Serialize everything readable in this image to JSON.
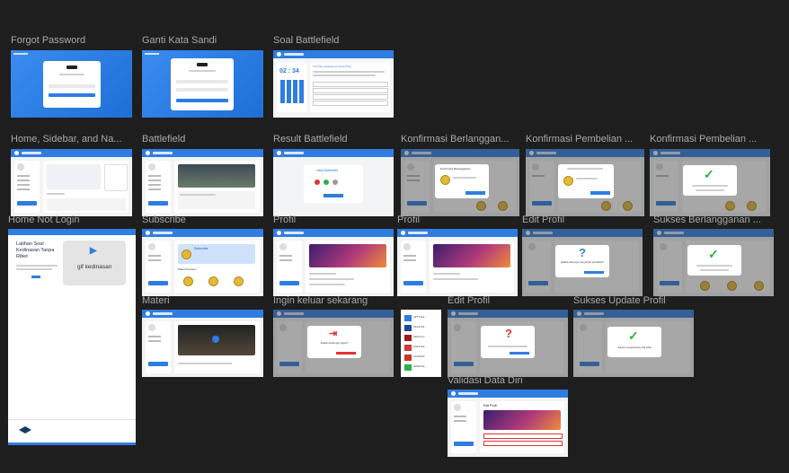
{
  "frames": {
    "forgot_password": "Forgot Password",
    "ganti_kata_sandi": "Ganti Kata Sandi",
    "soal_battlefield": "Soal Battlefield",
    "home_sidebar": "Home, Sidebar, and Na...",
    "battlefield": "Battlefield",
    "result_battlefield": "Result Battlefield",
    "konfirmasi_berlangganan": "Konfirmasi Berlanggan...",
    "konfirmasi_pembelian_1": "Konfirmasi Pembelian ...",
    "konfirmasi_pembelian_2": "Konfirmasi Pembelian ...",
    "home_not_login": "Home Not Login",
    "subscribe": "Subscribe",
    "profil_1": "Profil",
    "profil_2": "Profil",
    "edit_profil_1": "Edit Profil",
    "sukses_berlangganan": "Sukses Berlangganan ...",
    "materi": "Materi",
    "ingin_keluar": "Ingin keluar sekarang",
    "edit_profil_2": "Edit Profil",
    "sukses_update_profil": "Sukses Update Profil",
    "validasi_data_diri": "Validasi Data Diri"
  },
  "thumb_text": {
    "hero_title": "Latihan Soal Kedinasan Tanpa Ribet",
    "hero_media": "gif kedinasan",
    "timer": "02 : 34",
    "soal_title": "TKI (Tes Intelegensi Umum/TIU)",
    "hasil": "Hasil Battlefield",
    "konfirmasi": "Konfirmasi Berlangganan",
    "subscribe_title": "Subscribe",
    "paket": "Paket Premium",
    "edit_question": "Apakah anda ingin menyimpan perubahan?",
    "logout_question": "Apakah anda ingin logout?",
    "sukses_update": "Sukses memperbarui profil anda",
    "edit_title": "Edit Profil"
  },
  "colors": {
    "canvas": "#1e1e1e",
    "primary": "#2f7de1",
    "success": "#2bb04a",
    "danger": "#e03434",
    "coin": "#e2b93b"
  },
  "palette": [
    "#2f7de1",
    "#1a4c91",
    "#9b1c1c",
    "#d13a3a",
    "#c0392b",
    "#2bb04a"
  ]
}
